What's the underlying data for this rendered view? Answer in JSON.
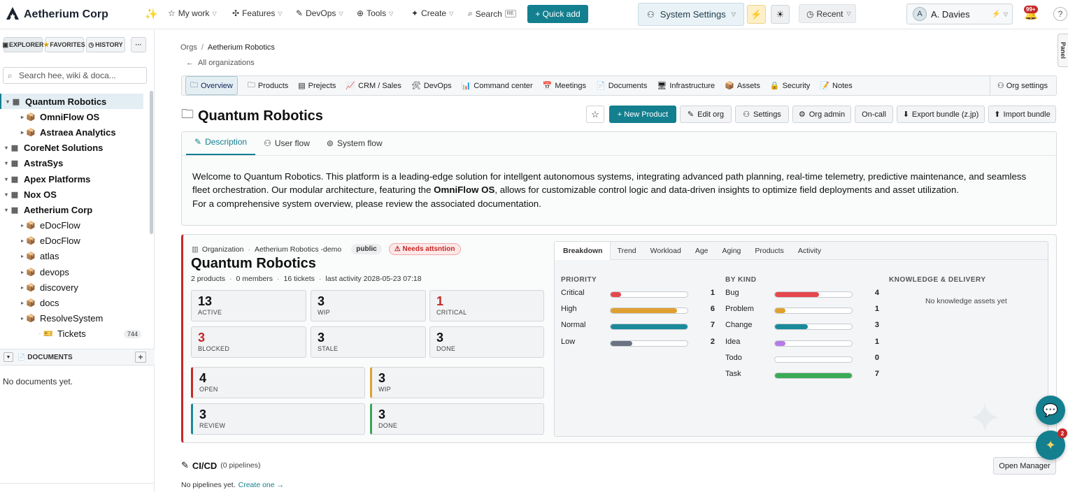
{
  "app": {
    "name": "Aetherium Corp"
  },
  "topnav": {
    "items": [
      "My work",
      "Features",
      "DevOps",
      "Tools",
      "Create"
    ],
    "search_label": "Search",
    "search_kbd": "RE",
    "quick_add": "+ Quick add",
    "system_settings": "System Settings",
    "recent": "Recent",
    "user_initial": "A",
    "user_name": "A. Davies",
    "notif_count": "99+"
  },
  "sidebar": {
    "tabs": [
      "EXPLORER",
      "FAVORITES",
      "HISTORY"
    ],
    "more": "···",
    "search_placeholder": "Search hee, wiki & doca...",
    "tree": [
      {
        "label": "Quantum Robotics",
        "level": 0,
        "bold": true,
        "selected": true,
        "icon": "org-icon"
      },
      {
        "label": "OmniFlow OS",
        "level": 1,
        "bold": true,
        "icon": "package-icon"
      },
      {
        "label": "Astraea Analytics",
        "level": 1,
        "bold": true,
        "icon": "package-icon"
      },
      {
        "label": "CoreNet Solutions",
        "level": 0,
        "bold": true,
        "icon": "org-icon"
      },
      {
        "label": "AstraSys",
        "level": 0,
        "bold": true,
        "icon": "org-icon"
      },
      {
        "label": "Apex Platforms",
        "level": 0,
        "bold": true,
        "icon": "org-icon"
      },
      {
        "label": "Nox OS",
        "level": 0,
        "bold": true,
        "icon": "org-icon"
      },
      {
        "label": "Aetherium Corp",
        "level": 0,
        "bold": true,
        "icon": "org-icon"
      },
      {
        "label": "eDocFlow",
        "level": 1,
        "icon": "package-icon"
      },
      {
        "label": "eDocFlow",
        "level": 1,
        "icon": "package-icon"
      },
      {
        "label": "atlas",
        "level": 1,
        "icon": "package-icon"
      },
      {
        "label": "devops",
        "level": 1,
        "icon": "package-icon"
      },
      {
        "label": "discovery",
        "level": 1,
        "icon": "package-icon"
      },
      {
        "label": "docs",
        "level": 1,
        "icon": "package-icon"
      },
      {
        "label": "ResolveSystem",
        "level": 1,
        "icon": "package-icon"
      },
      {
        "label": "Tickets",
        "level": 2,
        "icon": "ticket-icon",
        "count": "744"
      }
    ],
    "documents_label": "DOCUMENTS",
    "documents_empty": "No documents yet."
  },
  "breadcrumb": {
    "root": "Orgs",
    "current": "Aetherium Robotics",
    "back": "All organizations"
  },
  "navbar": {
    "items": [
      {
        "label": "Overview",
        "icon": "folder-icon",
        "active": true
      },
      {
        "label": "Products",
        "icon": "folder-icon"
      },
      {
        "label": "Prejects",
        "icon": "projects-icon"
      },
      {
        "label": "CRM / Sales",
        "icon": "crm-icon"
      },
      {
        "label": "DevOps",
        "icon": "wrench-icon"
      },
      {
        "label": "Command center",
        "icon": "chart-icon"
      },
      {
        "label": "Meetings",
        "icon": "calendar-icon"
      },
      {
        "label": "Documents",
        "icon": "document-icon"
      },
      {
        "label": "Infrastructure",
        "icon": "monitor-icon"
      },
      {
        "label": "Assets",
        "icon": "package-icon"
      },
      {
        "label": "Security",
        "icon": "lock-icon"
      },
      {
        "label": "Notes",
        "icon": "note-icon"
      }
    ],
    "org_settings": "Org settings"
  },
  "page": {
    "title": "Quantum Robotics",
    "actions": {
      "new_product": "+ New Product",
      "edit_org": "Edit org",
      "settings": "Settings",
      "org_admin": "Org admin",
      "on_call": "On-call",
      "export": "Export bundle (z.jp)",
      "import": "Import bundle"
    }
  },
  "description": {
    "tabs": [
      "Description",
      "User flow",
      "System flow"
    ],
    "text1": "Welcome to Quantum Robotics. This platform is a leading-edge solution for intellgent autonomous systems, integrating advanced path planning, real-time telemetry, predictive maintenance, and seamless fleet orchestration. Our modular architecture, featuring the ",
    "text_bold": "OmniFlow OS",
    "text2": ", allows for customizable control logic and data-driven insights to optimize field deployments and asset utilization.",
    "text3": "For a comprehensive system overview, please review the associated documentation."
  },
  "org": {
    "kind": "Organization",
    "parent": "Aetherium Robotics -demo",
    "visibility": "public",
    "attention": "Needs attsntion",
    "name": "Quantum Robotics",
    "meta": [
      "2 products",
      "0 members",
      "16 tickets",
      "last activity 2028-05-23 07:18"
    ],
    "stats": [
      {
        "n": "13",
        "l": "ACTIVE",
        "red": false
      },
      {
        "n": "3",
        "l": "WIP",
        "red": false
      },
      {
        "n": "1",
        "l": "CRITICAL",
        "red": true
      },
      {
        "n": "3",
        "l": "BLOCKED",
        "red": true
      },
      {
        "n": "3",
        "l": "STALE",
        "red": false
      },
      {
        "n": "3",
        "l": "DONE",
        "red": false
      }
    ],
    "flow": [
      {
        "n": "4",
        "l": "OPEN",
        "color": "#c62828"
      },
      {
        "n": "3",
        "l": "WIP",
        "color": "#e0a030"
      },
      {
        "n": "3",
        "l": "REVIEW",
        "color": "#1a8a9a"
      },
      {
        "n": "3",
        "l": "DONE",
        "color": "#3aa55a"
      }
    ]
  },
  "breakdown": {
    "tabs": [
      "Breakdown",
      "Trend",
      "Workload",
      "Age",
      "Aging",
      "Products",
      "Activity"
    ],
    "priority_title": "PRIORITY",
    "priority": [
      {
        "label": "Critical",
        "count": "1",
        "pct": 0.14,
        "color": "#e5484d"
      },
      {
        "label": "High",
        "count": "6",
        "pct": 0.86,
        "color": "#e0a030"
      },
      {
        "label": "Normal",
        "count": "7",
        "pct": 1.0,
        "color": "#1a8a9a"
      },
      {
        "label": "Low",
        "count": "2",
        "pct": 0.28,
        "color": "#6b7280"
      }
    ],
    "kind_title": "BY KIND",
    "kind": [
      {
        "label": "Bug",
        "count": "4",
        "pct": 0.57,
        "color": "#e5484d"
      },
      {
        "label": "Problem",
        "count": "1",
        "pct": 0.14,
        "color": "#e0a030"
      },
      {
        "label": "Change",
        "count": "3",
        "pct": 0.43,
        "color": "#1a8a9a"
      },
      {
        "label": "Idea",
        "count": "1",
        "pct": 0.14,
        "color": "#b57be8"
      },
      {
        "label": "Todo",
        "count": "0",
        "pct": 0.0,
        "color": "#3aa55a"
      },
      {
        "label": "Task",
        "count": "7",
        "pct": 1.0,
        "color": "#3aaa55"
      }
    ],
    "knowledge_title": "KNOWLEDGE & DELIVERY",
    "knowledge_empty": "No knowledge assets yet"
  },
  "cicd": {
    "title": "CI/CD",
    "count": "(0 pipelines)",
    "empty": "No pipelines yet.",
    "create": "Create one →",
    "open_manager": "Open Manager"
  },
  "panel_label": "Panel",
  "assistant_badge": "2"
}
